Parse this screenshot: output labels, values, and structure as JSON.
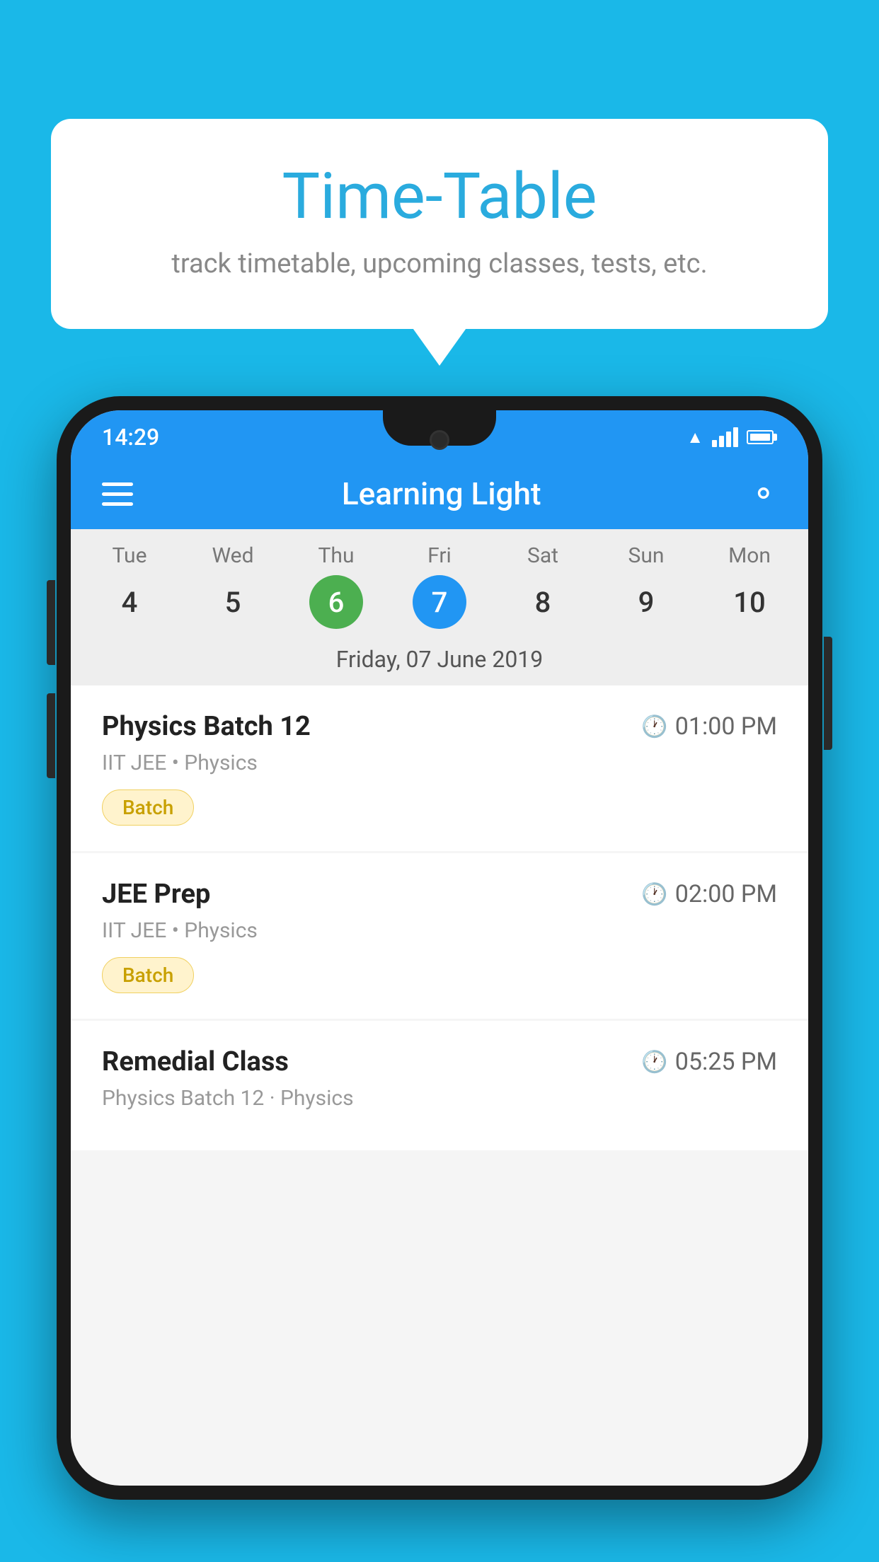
{
  "background_color": "#1ab8e8",
  "bubble": {
    "title": "Time-Table",
    "subtitle": "track timetable, upcoming classes, tests, etc."
  },
  "phone": {
    "status_bar": {
      "time": "14:29"
    },
    "app_bar": {
      "title": "Learning Light"
    },
    "calendar": {
      "days": [
        {
          "label": "Tue",
          "number": "4",
          "state": "normal"
        },
        {
          "label": "Wed",
          "number": "5",
          "state": "normal"
        },
        {
          "label": "Thu",
          "number": "6",
          "state": "today"
        },
        {
          "label": "Fri",
          "number": "7",
          "state": "selected"
        },
        {
          "label": "Sat",
          "number": "8",
          "state": "normal"
        },
        {
          "label": "Sun",
          "number": "9",
          "state": "normal"
        },
        {
          "label": "Mon",
          "number": "10",
          "state": "normal"
        }
      ],
      "selected_date_label": "Friday, 07 June 2019"
    },
    "schedule": [
      {
        "title": "Physics Batch 12",
        "time": "01:00 PM",
        "meta": "IIT JEE • Physics",
        "badge": "Batch"
      },
      {
        "title": "JEE Prep",
        "time": "02:00 PM",
        "meta": "IIT JEE • Physics",
        "badge": "Batch"
      },
      {
        "title": "Remedial Class",
        "time": "05:25 PM",
        "meta": "Physics Batch 12 · Physics",
        "badge": null
      }
    ]
  }
}
